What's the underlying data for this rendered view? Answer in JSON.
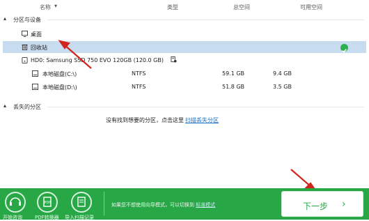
{
  "header": {
    "name": "名称",
    "type": "类型",
    "total": "总空间",
    "free": "可用空间"
  },
  "sections": {
    "partitions": "分区与设备",
    "lost": "丢失的分区"
  },
  "tree": {
    "desktop": "桌面",
    "recycle": "回收站",
    "disk": "HD0: Samsung SSD 750 EVO 120GB (120.0 GB)",
    "c": {
      "name": "本地磁盘(C:\\)",
      "fs": "NTFS",
      "total": "59.1 GB",
      "free": "9.4 GB"
    },
    "d": {
      "name": "本地磁盘(D:\\)",
      "fs": "NTFS",
      "total": "51.8 GB",
      "free": "3.5 GB"
    }
  },
  "lost": {
    "msg": "没有找到想要的分区，点击这里",
    "link": "扫描丢失分区"
  },
  "footer": {
    "btn1": "开始咨询",
    "btn2": "PDF转换器",
    "btn3": "导入扫描记录",
    "hint": "如果您不想使用向导模式，可以切换到",
    "hint_link": "标准模式",
    "next": "下一步"
  },
  "colors": {
    "accent": "#27a745",
    "selection": "#c7dcef",
    "arrow": "#d0261e"
  }
}
